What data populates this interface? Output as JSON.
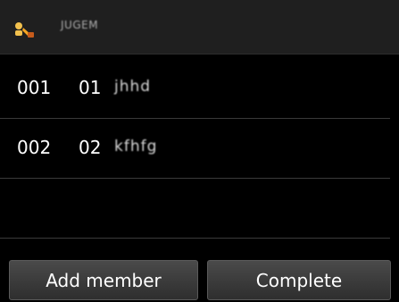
{
  "header": {
    "icon": "group-dial-icon",
    "title": "JUGEM"
  },
  "members": [
    {
      "number": "001",
      "code": "01",
      "name": "jhhd"
    },
    {
      "number": "002",
      "code": "02",
      "name": "kfhfg"
    }
  ],
  "buttons": {
    "add_member": "Add member",
    "complete": "Complete"
  }
}
